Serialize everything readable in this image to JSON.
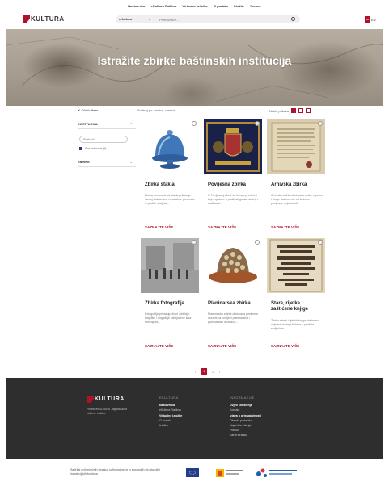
{
  "topnav": {
    "items": [
      "Naslovnica",
      "eKultura Rafišna",
      "Virtualne izložbe",
      "O portalu",
      "Izložbe",
      "Pomoć"
    ]
  },
  "brand": {
    "name": "KULTURA",
    "accent_color": "#b0122b"
  },
  "search": {
    "scope_label": "eKultura",
    "placeholder": "Pretraži sve..."
  },
  "language": {
    "code": "HR",
    "label": "EN"
  },
  "hero": {
    "title": "Istražite zbirke baštinskih institucija"
  },
  "filters": {
    "clear_label": "Očisti filtere",
    "sections": [
      {
        "title": "INSTITUCIJA"
      },
      {
        "title": "ZBIRKE"
      }
    ],
    "search_placeholder": "Pretraži...",
    "checkbox_label": "Sve ustanove (1)"
  },
  "sort": {
    "label": "Sortiraj po: nazivu, rastuće"
  },
  "view": {
    "label": "Način prikaza"
  },
  "cards": [
    {
      "title": "Zbirka stakla",
      "desc": "Zbirka predmeta od stakla prikazuje razvoj staklarstva i uporabne predmete iz prošlih stoljeća...",
      "link": "SAZNAJTE VIŠE"
    },
    {
      "title": "Povijesna zbirka",
      "desc": "U Povijesnoj zbirci se čuvaju predmeti koji svjedoče o prošlosti grada, obitelji i institucija...",
      "link": "SAZNAJTE VIŠE"
    },
    {
      "title": "Arhivska zbirka",
      "desc": "Arhivska zbirka obuhvaća spise, isprave i druge dokumente od iznimne povijesne vrijednosti...",
      "link": "SAZNAJTE VIŠE"
    },
    {
      "title": "Zbirka fotografija",
      "desc": "Fotografije prikazuju život i običaje, krajolike i događaje zabilježene kroz desetljeća...",
      "link": "SAZNAJTE VIŠE"
    },
    {
      "title": "Planinarska zbirka",
      "desc": "Planinarska zbirka obuhvaća predmete vezane uz povijest planinarstva i planinarskih društava...",
      "link": "SAZNAJTE VIŠE"
    },
    {
      "title": "Stare, rijetke i zaštićene knjige",
      "desc": "Zbirka starih i rijetkih knjiga obuhvaća vrijedna izdanja tiskana u prošlim stoljećima...",
      "link": "SAZNAJTE VIŠE"
    }
  ],
  "pagination": {
    "prev": "‹",
    "current": "1",
    "next_page": "2",
    "next": "›"
  },
  "footer": {
    "desc": "Projekt eKULTURA - digitalizacija kulturne baštine",
    "col1": {
      "head": "EKULTURA",
      "items": [
        {
          "label": "Naslovnica",
          "strong": true
        },
        {
          "label": "eKultura Rafišna",
          "strong": false
        },
        {
          "label": "Virtualne izložbe",
          "strong": true
        },
        {
          "label": "O portalu",
          "strong": false
        },
        {
          "label": "Izložbe",
          "strong": false
        }
      ]
    },
    "col2": {
      "head": "INFORMACIJE",
      "items": [
        {
          "label": "Uvjeti korištenja",
          "strong": true
        },
        {
          "label": "Kontakt",
          "strong": false
        },
        {
          "label": "Izjava o pristupačnosti",
          "strong": true
        },
        {
          "label": "Obrada podataka",
          "strong": false
        },
        {
          "label": "Najčešća pitanja",
          "strong": false
        },
        {
          "label": "Pomoć",
          "strong": false
        },
        {
          "label": "Karta stranica",
          "strong": false
        }
      ]
    }
  },
  "eu": {
    "text": "Sadržaj ovih mrežnih stranica sufinanciran je iz europskih strukturnih i investicijskih fondova"
  }
}
